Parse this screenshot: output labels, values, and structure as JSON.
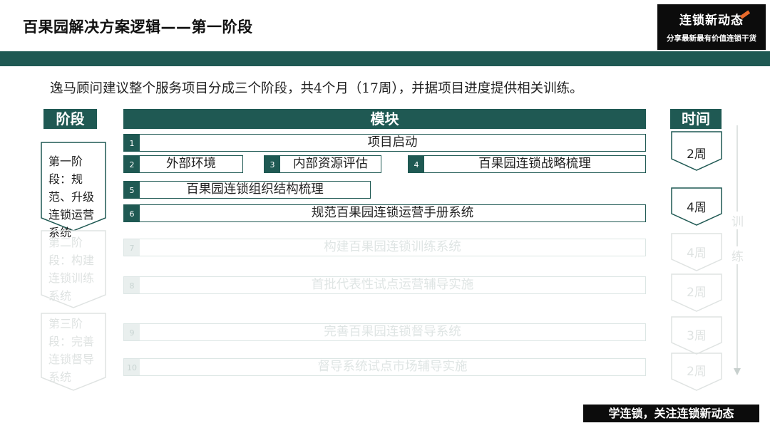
{
  "title": "百果园解决方案逻辑——第一阶段",
  "logo": {
    "line1": "连锁新动态",
    "line2": "分享最新最有价值连锁干货"
  },
  "intro": "逸马顾问建议整个服务项目分成三个阶段，共4个月（17周），并据项目进度提供相关训练。",
  "headers": {
    "phase": "阶段",
    "module": "模块",
    "time": "时间"
  },
  "phases": [
    {
      "text": "第一阶段：规范、升级连锁运营系统"
    },
    {
      "text": "第二阶段：构建连锁训练系统"
    },
    {
      "text": "第三阶段：完善连锁督导系统"
    }
  ],
  "modules": [
    {
      "num": "1",
      "label": "项目启动"
    },
    {
      "num": "2",
      "label": "外部环境"
    },
    {
      "num": "3",
      "label": "内部资源评估"
    },
    {
      "num": "4",
      "label": "百果园连锁战略梳理"
    },
    {
      "num": "5",
      "label": "百果园连锁组织结构梳理"
    },
    {
      "num": "6",
      "label": "规范百果园连锁运营手册系统"
    },
    {
      "num": "7",
      "label": "构建百果园连锁训练系统"
    },
    {
      "num": "8",
      "label": "首批代表性试点运营辅导实施"
    },
    {
      "num": "9",
      "label": "完善百果园连锁督导系统"
    },
    {
      "num": "10",
      "label": "督导系统试点市场辅导实施"
    }
  ],
  "times": [
    "2周",
    "4周",
    "4周",
    "2周",
    "3周",
    "2周"
  ],
  "training": {
    "char1": "训",
    "char2": "练"
  },
  "footer": "学连锁，关注连锁新动态",
  "colors": {
    "accent": "#1f5953",
    "faded": "#dfe3e2"
  }
}
